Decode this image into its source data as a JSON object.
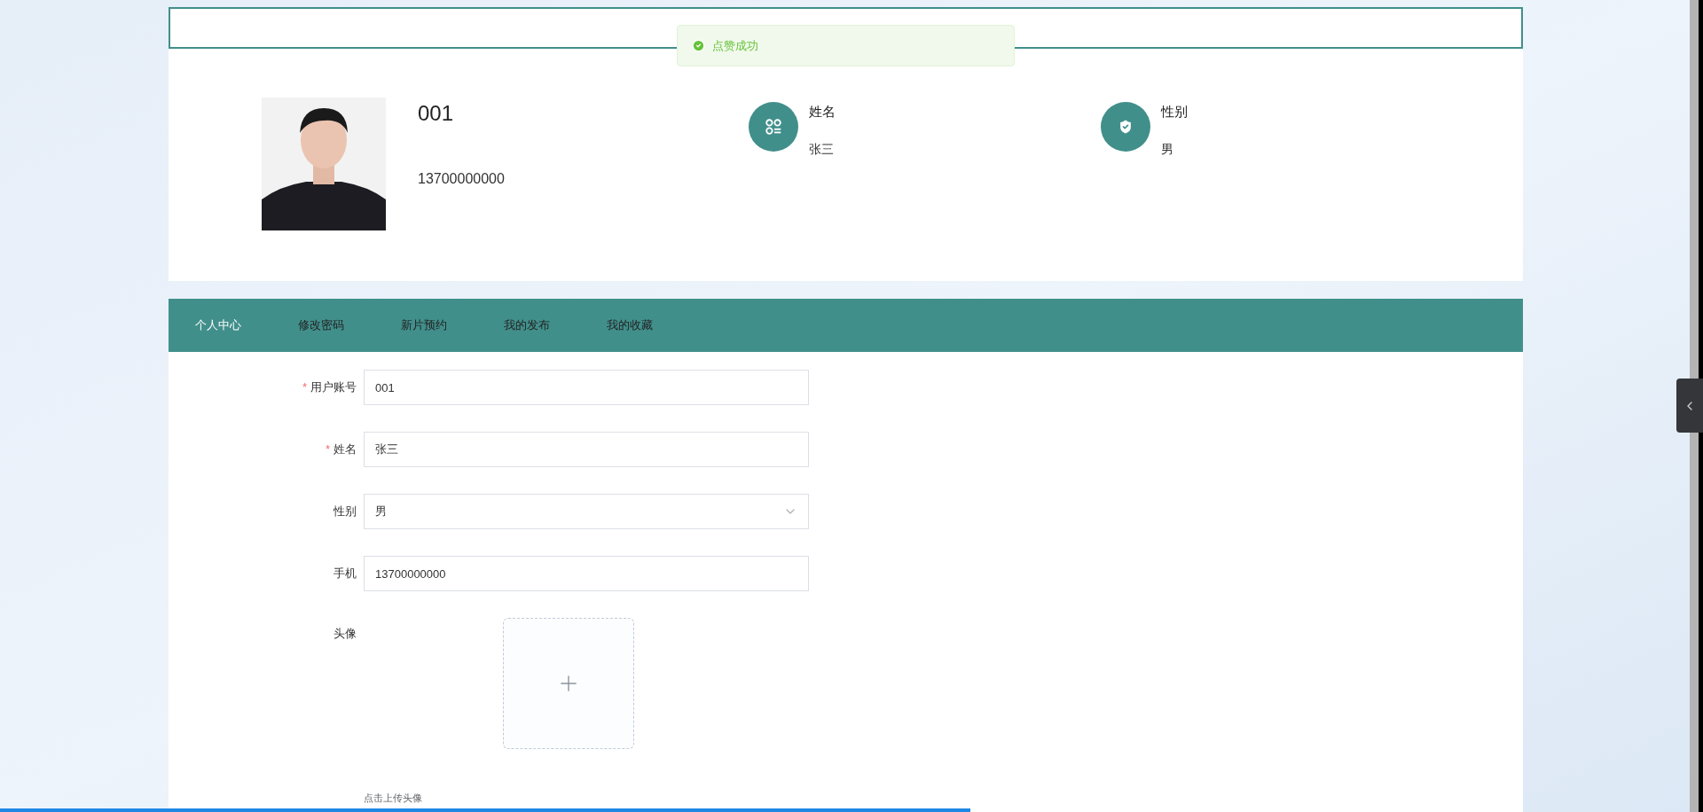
{
  "toast": {
    "message": "点赞成功"
  },
  "profile": {
    "account": "001",
    "phone": "13700000000",
    "stats": [
      {
        "kind": "name",
        "label": "姓名",
        "value": "张三"
      },
      {
        "kind": "gender",
        "label": "性别",
        "value": "男"
      }
    ]
  },
  "tabs": [
    {
      "label": "个人中心",
      "selected": true
    },
    {
      "label": "修改密码",
      "selected": false
    },
    {
      "label": "新片预约",
      "selected": false
    },
    {
      "label": "我的发布",
      "selected": false
    },
    {
      "label": "我的收藏",
      "selected": false
    }
  ],
  "player_progress": {
    "level": 0.57
  },
  "form": {
    "required_mark": "*",
    "fields": [
      {
        "kind": "input",
        "label": "用户账号",
        "required": true,
        "value": "001"
      },
      {
        "kind": "input",
        "label": "姓名",
        "required": true,
        "value": "张三"
      },
      {
        "kind": "select",
        "label": "性别",
        "required": false,
        "value": "男"
      },
      {
        "kind": "input",
        "label": "手机",
        "required": false,
        "value": "13700000000"
      },
      {
        "kind": "upload",
        "label": "头像",
        "required": false,
        "hint": "点击上传头像"
      }
    ]
  }
}
